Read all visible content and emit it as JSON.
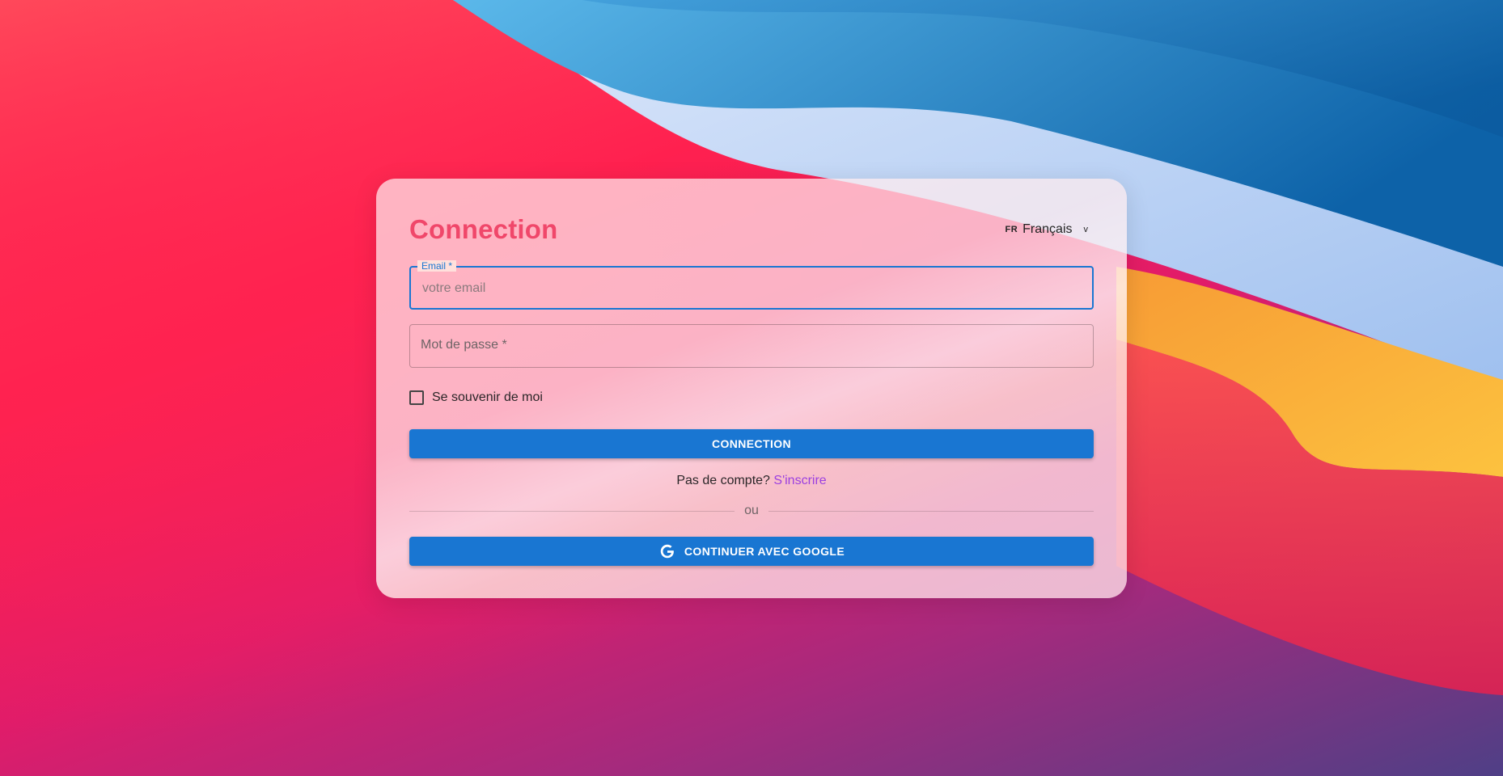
{
  "login": {
    "title": "Connection",
    "language": {
      "flag": "FR",
      "label": "Français",
      "chevron": "v"
    },
    "email": {
      "label": "Email *",
      "placeholder": "votre email",
      "value": ""
    },
    "password": {
      "label": "Mot de passe *",
      "value": ""
    },
    "remember": {
      "label": "Se souvenir de moi",
      "checked": false
    },
    "submit_label": "CONNECTION",
    "signup": {
      "prompt": "Pas de compte?",
      "link": "S'inscrire"
    },
    "divider": "ou",
    "google_label": "CONTINUER AVEC GOOGLE"
  },
  "colors": {
    "title": "#f0476a",
    "primary": "#1976d2",
    "link": "#9c40e0"
  },
  "icons": [
    "google-icon",
    "checkbox-icon",
    "chevron-down-icon"
  ]
}
